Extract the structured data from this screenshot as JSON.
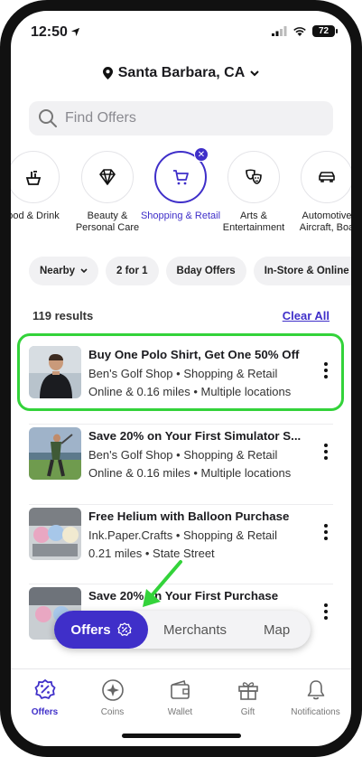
{
  "status_bar": {
    "time": "12:50",
    "battery": "72"
  },
  "location": {
    "label": "Santa Barbara, CA"
  },
  "search": {
    "placeholder": "Find Offers"
  },
  "categories": [
    {
      "label": "ood & Drink",
      "icon": "food-icon",
      "active": false
    },
    {
      "label": "Beauty & Personal Care",
      "icon": "diamond-icon",
      "active": false
    },
    {
      "label": "Shopping & Retail",
      "icon": "cart-icon",
      "active": true
    },
    {
      "label": "Arts & Entertainment",
      "icon": "theater-masks-icon",
      "active": false
    },
    {
      "label": "Automotive Aircraft, Boa",
      "icon": "car-icon",
      "active": false
    }
  ],
  "filters": [
    "Nearby",
    "2 for 1",
    "Bday Offers",
    "In-Store & Online"
  ],
  "results": {
    "count": "119 results",
    "clear": "Clear All"
  },
  "offers": [
    {
      "title": "Buy One Polo Shirt, Get One 50% Off",
      "merchant": "Ben's Golf Shop • Shopping & Retail",
      "detail": "Online & 0.16 miles • Multiple locations"
    },
    {
      "title": "Save 20% on Your First Simulator S...",
      "merchant": "Ben's Golf Shop • Shopping & Retail",
      "detail": "Online & 0.16 miles • Multiple locations"
    },
    {
      "title": "Free Helium with Balloon Purchase",
      "merchant": "Ink.Paper.Crafts • Shopping & Retail",
      "detail": "0.21 miles • State Street"
    },
    {
      "title": "Save 20% on Your First Purchase",
      "merchant": "",
      "detail": ""
    }
  ],
  "toggle": {
    "active": "Offers",
    "merchants": "Merchants",
    "map": "Map"
  },
  "tabs": [
    {
      "label": "Offers",
      "icon": "offers-icon",
      "active": true
    },
    {
      "label": "Coins",
      "icon": "coins-icon",
      "active": false
    },
    {
      "label": "Wallet",
      "icon": "wallet-icon",
      "active": false
    },
    {
      "label": "Gift",
      "icon": "gift-icon",
      "active": false
    },
    {
      "label": "Notifications",
      "icon": "bell-icon",
      "active": false
    }
  ],
  "colors": {
    "accent": "#3f2fc9",
    "highlight": "#33d33a"
  }
}
